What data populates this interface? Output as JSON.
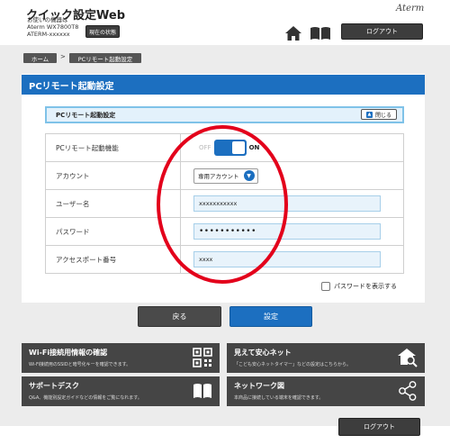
{
  "header": {
    "title": "クイック設定Web",
    "device_caption": "お使いの機器は",
    "device_model": "Aterm WX7800T8",
    "device_name": "ATERM-xxxxxx",
    "status_button": "現在の状態",
    "brand": "Aterm",
    "logout": "ログアウト"
  },
  "breadcrumb": {
    "home": "ホーム",
    "separator": ">",
    "current": "PCリモート起動設定"
  },
  "page": {
    "title": "PCリモート起動設定",
    "section_title": "PCリモート起動設定",
    "close_button": "閉じる"
  },
  "form": {
    "function_label": "PCリモート起動機能",
    "toggle_off": "OFF",
    "toggle_on": "ON",
    "account_label": "アカウント",
    "account_value": "専用アカウント",
    "username_label": "ユーザー名",
    "username_value": "xxxxxxxxxxx",
    "password_label": "パスワード",
    "password_value": "•••••••••••",
    "port_label": "アクセスポート番号",
    "port_value": "xxxx",
    "show_password": "パスワードを表示する"
  },
  "buttons": {
    "back": "戻る",
    "save": "設定"
  },
  "tiles": [
    {
      "title": "Wi-Fi接続用情報の確認",
      "desc": "Wi-Fi接続用のSSIDと暗号化キーを確認できます。",
      "icon": "qr-code-icon"
    },
    {
      "title": "見えて安心ネット",
      "desc": "「こども安心ネットタイマー」などの設定はこちらから。",
      "icon": "home-search-icon"
    },
    {
      "title": "サポートデスク",
      "desc": "Q&A、機能別設定ガイドなどの情報をご覧になれます。",
      "icon": "book-icon"
    },
    {
      "title": "ネットワーク図",
      "desc": "本商品に接続している端末を確認できます。",
      "icon": "network-icon"
    }
  ],
  "footer": {
    "logout": "ログアウト"
  },
  "colors": {
    "accent": "#1c6fc0",
    "dark": "#454545",
    "highlight": "#e3001b"
  }
}
